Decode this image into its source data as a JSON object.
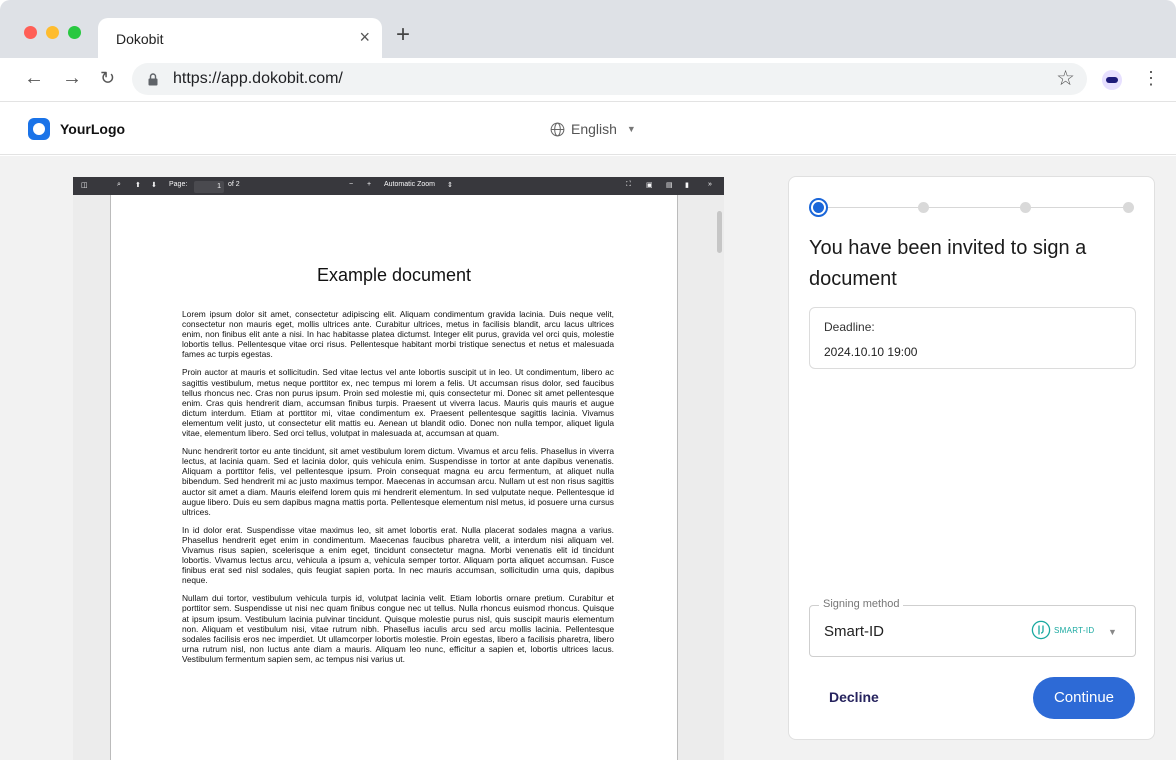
{
  "browser": {
    "tab_title": "Dokobit",
    "tab_close": "×",
    "new_tab": "+",
    "url": "https://app.dokobit.com/"
  },
  "app": {
    "logo_text": "YourLogo",
    "language": "English"
  },
  "pdf_viewer": {
    "page_label": "Page:",
    "page_current": "1",
    "page_total": "of 2",
    "zoom_out": "−",
    "zoom_in": "+",
    "zoom_level": "Automatic Zoom",
    "document_title": "Example document",
    "paragraphs": [
      "Lorem ipsum dolor sit amet, consectetur adipiscing elit. Aliquam condimentum gravida lacinia. Duis neque velit, consectetur non mauris eget, mollis ultrices ante. Curabitur ultrices, metus in facilisis blandit, arcu lacus ultrices enim, non finibus elit ante a nisi. In hac habitasse platea dictumst. Integer elit purus, gravida vel orci quis, molestie lobortis tellus. Pellentesque vitae orci risus. Pellentesque habitant morbi tristique senectus et netus et malesuada fames ac turpis egestas.",
      "Proin auctor at mauris et sollicitudin. Sed vitae lectus vel ante lobortis suscipit ut in leo. Ut condimentum, libero ac sagittis vestibulum, metus neque porttitor ex, nec tempus mi lorem a felis. Ut accumsan risus dolor, sed faucibus tellus rhoncus nec. Cras non purus ipsum. Proin sed molestie mi, quis consectetur mi. Donec sit amet pellentesque enim. Cras quis hendrerit diam, accumsan finibus turpis. Praesent ut viverra lacus. Mauris quis mauris et augue dictum interdum. Etiam at porttitor mi, vitae condimentum ex. Praesent pellentesque sagittis lacinia. Vivamus elementum velit justo, ut consectetur elit mattis eu. Aenean ut blandit odio. Donec non nulla tempor, aliquet ligula vitae, elementum libero. Sed orci tellus, volutpat in malesuada at, accumsan at quam.",
      "Nunc hendrerit tortor eu ante tincidunt, sit amet vestibulum lorem dictum. Vivamus et arcu felis. Phasellus in viverra lectus, at lacinia quam. Sed et lacinia dolor, quis vehicula enim. Suspendisse in tortor at ante dapibus venenatis. Aliquam a porttitor felis, vel pellentesque ipsum. Proin consequat magna eu arcu fermentum, at aliquet nulla bibendum. Sed hendrerit mi ac justo maximus tempor. Maecenas in accumsan arcu. Nullam ut est non risus sagittis auctor sit amet a diam. Mauris eleifend lorem quis mi hendrerit elementum. In sed vulputate neque. Pellentesque id augue libero. Duis eu sem dapibus magna mattis porta. Pellentesque elementum nisl metus, id posuere urna cursus ultrices.",
      "In id dolor erat. Suspendisse vitae maximus leo, sit amet lobortis erat. Nulla placerat sodales magna a varius. Phasellus hendrerit eget enim in condimentum. Maecenas faucibus pharetra velit, a interdum nisi aliquam vel. Vivamus risus sapien, scelerisque a enim eget, tincidunt consectetur magna. Morbi venenatis elit id tincidunt lobortis. Vivamus lectus arcu, vehicula a ipsum a, vehicula semper tortor. Aliquam porta aliquet accumsan. Fusce finibus erat sed nisl sodales, quis feugiat sapien porta. In nec mauris accumsan, sollicitudin urna quis, dapibus neque.",
      "Nullam dui tortor, vestibulum vehicula turpis id, volutpat lacinia velit. Etiam lobortis ornare pretium. Curabitur et porttitor sem. Suspendisse ut nisi nec quam finibus congue nec ut tellus. Nulla rhoncus euismod rhoncus. Quisque at ipsum ipsum. Vestibulum lacinia pulvinar tincidunt. Quisque molestie purus nisl, quis suscipit mauris elementum non. Aliquam et vestibulum nisi, vitae rutrum nibh. Phasellus iaculis arcu sed arcu mollis lacinia. Pellentesque sodales facilisis eros nec imperdiet. Ut ullamcorper lobortis molestie. Proin egestas, libero a facilisis pharetra, libero urna rutrum nisl, non luctus ante diam a mauris. Aliquam leo nunc, efficitur a sapien et, lobortis ultrices lacus. Vestibulum fermentum sapien sem, ac tempus nisi varius ut."
    ]
  },
  "signing": {
    "steps_total": 4,
    "current_step": 1,
    "heading": "You have been invited to sign a document",
    "deadline_label": "Deadline:",
    "deadline_value": "2024.10.10 19:00",
    "method_label": "Signing method",
    "method_value": "Smart-ID",
    "method_logo_text": "SMART-ID",
    "decline_label": "Decline",
    "continue_label": "Continue",
    "accent_color": "#2d6ad6"
  }
}
